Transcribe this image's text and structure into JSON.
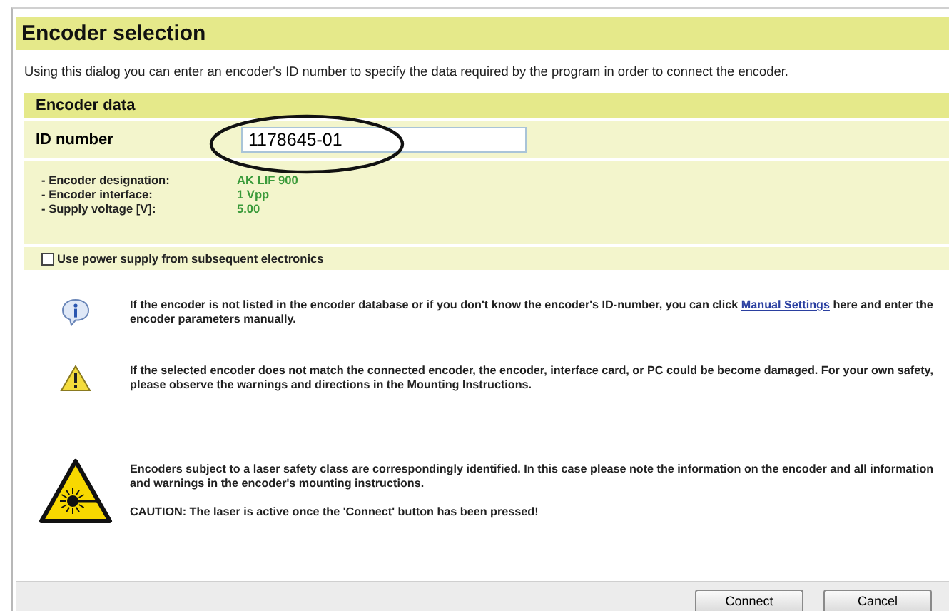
{
  "title": "Encoder selection",
  "description": "Using this dialog you can enter an encoder's ID number to specify the data required by the program in order to connect the encoder.",
  "encoder_data": {
    "header": "Encoder data",
    "id_label": "ID number",
    "id_value": "1178645-01",
    "details": [
      {
        "label": "- Encoder designation:",
        "value": "AK LIF 900"
      },
      {
        "label": "- Encoder interface:",
        "value": "1 Vpp"
      },
      {
        "label": "- Supply voltage [V]:",
        "value": "5.00"
      }
    ],
    "power_option": {
      "label": "Use power supply from subsequent electronics",
      "checked": false
    }
  },
  "notes": [
    {
      "kind": "info",
      "text": "If the encoder is not listed in the encoder database or if you don't know the encoder's ID-number, you can click",
      "link": "Manual Settings",
      "text_after": "here and enter the encoder parameters manually."
    },
    {
      "kind": "warning",
      "text": "If the selected encoder does not match the connected encoder, the encoder, interface card, or PC could be become damaged. For your own safety, please observe the warnings and directions in the Mounting Instructions."
    },
    {
      "kind": "laser",
      "text": "Encoders subject to a laser safety class are correspondingly identified. In this case please note the information on the encoder and all information and warnings in the encoder's mounting instructions.",
      "caution": "CAUTION: The laser is active once the 'Connect' button has been pressed!"
    }
  ],
  "buttons": [
    "Connect",
    "Cancel"
  ]
}
